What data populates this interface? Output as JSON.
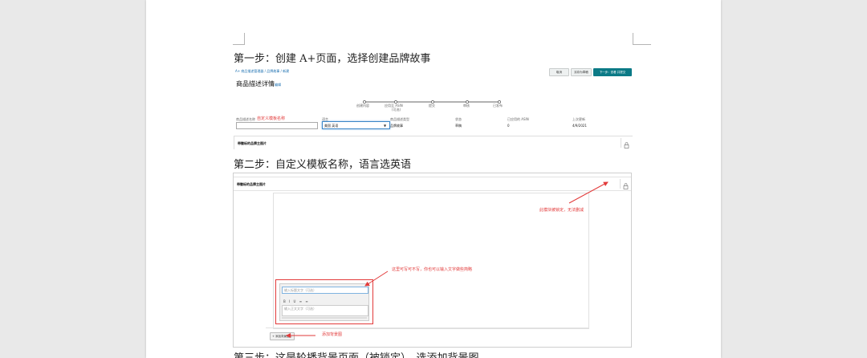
{
  "steps": {
    "step1": "第一步：创建 A+页面，选择创建品牌故事",
    "step2": "第二步：自定义模板名称，语言选英语",
    "step3": "第三步：这是轮播背景页面（被锁定），选添加背景图"
  },
  "screenshot1": {
    "breadcrumb": "A+ 商品描述管理器  /  品牌故事  /  新建",
    "buttons": [
      "取消",
      "另存为草稿",
      "下一步：查看 并提交"
    ],
    "title": "商品描述详情",
    "title_link": "编辑",
    "progress_steps": [
      "创建内容",
      "应用至 ASIN",
      "提交",
      "审核",
      "已发布"
    ],
    "progress_sub": "(可选)",
    "fields": {
      "template_name_label": "商品描述名称",
      "template_name_hint": "自定义模板名称",
      "language_label": "语言",
      "language_value": "美国 英语",
      "content_type_label": "商品描述类型",
      "content_type_value": "品牌故事",
      "status_label": "状态",
      "status_value": "草稿",
      "asin_label": "已应用的 ASIN",
      "asin_value": "0",
      "updated_label": "上次更新",
      "updated_value": "4/9/2021"
    },
    "module_title": "带徽标的品牌主图片"
  },
  "screenshot2": {
    "module_title": "带徽标的品牌主图片",
    "annotations": {
      "locked": "此模块被锁定，无法删减",
      "optional_text": "这里可写可不写，你也可以输入文字做些简略",
      "add_background": "添加背景图"
    },
    "mini_input_placeholder": "输入标题文字（可选）",
    "mini_body_placeholder": "输入正文文字（可选）",
    "toolbar": [
      "B",
      "I",
      "U",
      "≡",
      "≡"
    ],
    "add_image_button": "+ 添加背景图片"
  }
}
